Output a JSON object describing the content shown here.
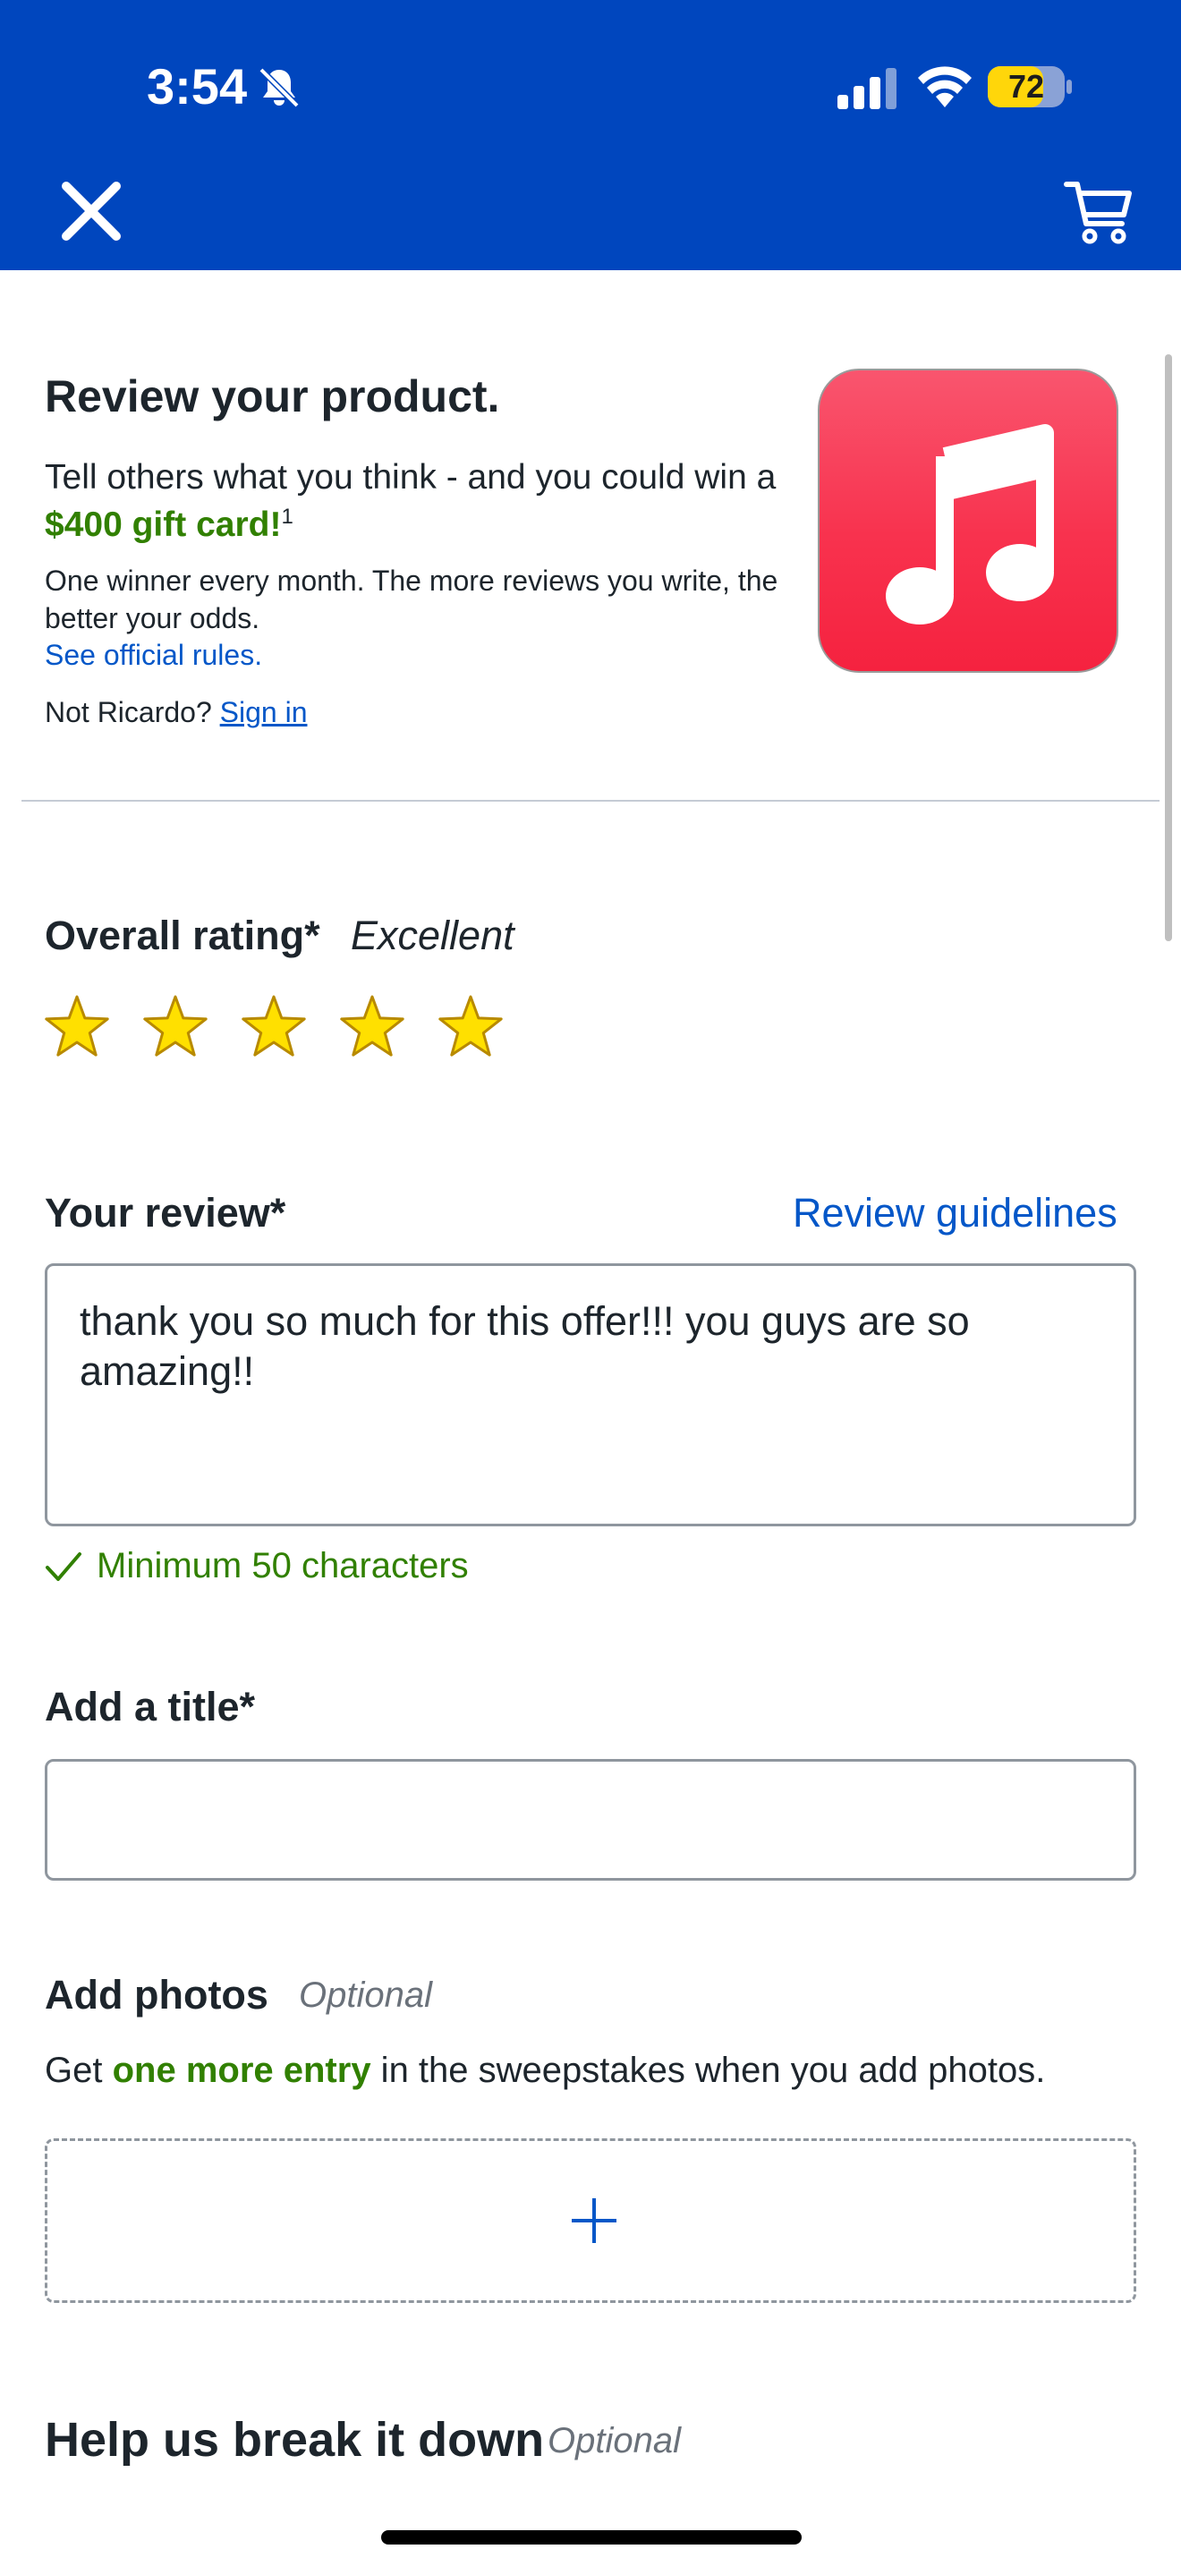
{
  "status_bar": {
    "time": "3:54",
    "battery_level": "72",
    "icons": [
      "bell-slash-icon",
      "cellular-signal-icon",
      "wifi-icon",
      "battery-icon"
    ]
  },
  "header": {
    "close_icon": "close-icon",
    "cart_icon": "shopping-cart-icon",
    "brand_color": "#0046be"
  },
  "intro": {
    "heading": "Review your product.",
    "tell_prefix": "Tell others what you think - and you could win a ",
    "prize": "$400 gift card!",
    "footnote": "1",
    "winner_text": "One winner every month. The more reviews you write, the better your odds.",
    "rules_link": "See official rules.",
    "not_user": "Not Ricardo? ",
    "sign_in": "Sign in",
    "product_icon": "apple-music-note-icon"
  },
  "rating": {
    "label": "Overall rating*",
    "value_word": "Excellent",
    "stars_filled": 5,
    "stars_total": 5,
    "star_color": "#ffe000"
  },
  "review": {
    "label": "Your review*",
    "guidelines_link": "Review guidelines",
    "text": "thank you so much for this offer!!! you guys are so amazing!!",
    "requirement": "Minimum 50 characters"
  },
  "title_field": {
    "label": "Add a title*",
    "value": ""
  },
  "photos": {
    "label": "Add photos",
    "optional": "Optional",
    "text_prefix": "Get ",
    "highlight": "one more entry",
    "text_suffix": " in the sweepstakes when you add photos."
  },
  "breakdown": {
    "label": "Help us break it down",
    "optional": "Optional"
  },
  "colors": {
    "link": "#0457c8",
    "success": "#318000"
  }
}
